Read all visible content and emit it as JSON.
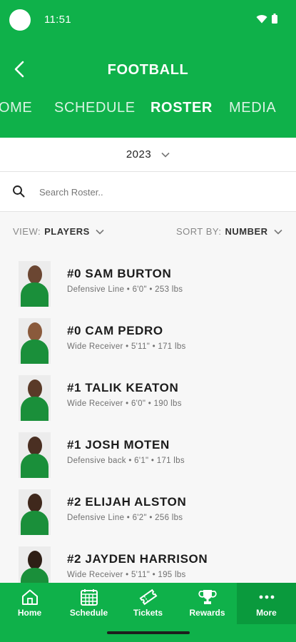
{
  "status": {
    "time": "11:51"
  },
  "header": {
    "title": "FOOTBALL"
  },
  "tabs": [
    {
      "label": "HOME",
      "visible_label": "OME"
    },
    {
      "label": "SCHEDULE"
    },
    {
      "label": "ROSTER",
      "active": true
    },
    {
      "label": "MEDIA"
    }
  ],
  "year": {
    "value": "2023"
  },
  "search": {
    "placeholder": "Search Roster..",
    "value": ""
  },
  "filters": {
    "view_label": "VIEW:",
    "view_value": "PLAYERS",
    "sort_label": "SORT BY:",
    "sort_value": "NUMBER"
  },
  "roster": [
    {
      "name": "#0 SAM BURTON",
      "meta": "Defensive Line • 6'0\" • 253 lbs"
    },
    {
      "name": "#0 CAM PEDRO",
      "meta": "Wide Receiver • 5'11\" • 171 lbs"
    },
    {
      "name": "#1 TALIK KEATON",
      "meta": "Wide Receiver • 6'0\" • 190 lbs"
    },
    {
      "name": "#1 JOSH MOTEN",
      "meta": "Defensive back • 6'1\" • 171 lbs"
    },
    {
      "name": "#2 ELIJAH ALSTON",
      "meta": "Defensive Line • 6'2\" • 256 lbs"
    },
    {
      "name": "#2 JAYDEN HARRISON",
      "meta": "Wide Receiver • 5'11\" • 195 lbs"
    }
  ],
  "nav": [
    {
      "label": "Home",
      "icon": "home-icon"
    },
    {
      "label": "Schedule",
      "icon": "calendar-icon"
    },
    {
      "label": "Tickets",
      "icon": "ticket-icon"
    },
    {
      "label": "Rewards",
      "icon": "trophy-icon"
    },
    {
      "label": "More",
      "icon": "more-icon",
      "active": true
    }
  ],
  "colors": {
    "brand_green": "#0fb14a",
    "active_nav": "#0a9a3d"
  }
}
